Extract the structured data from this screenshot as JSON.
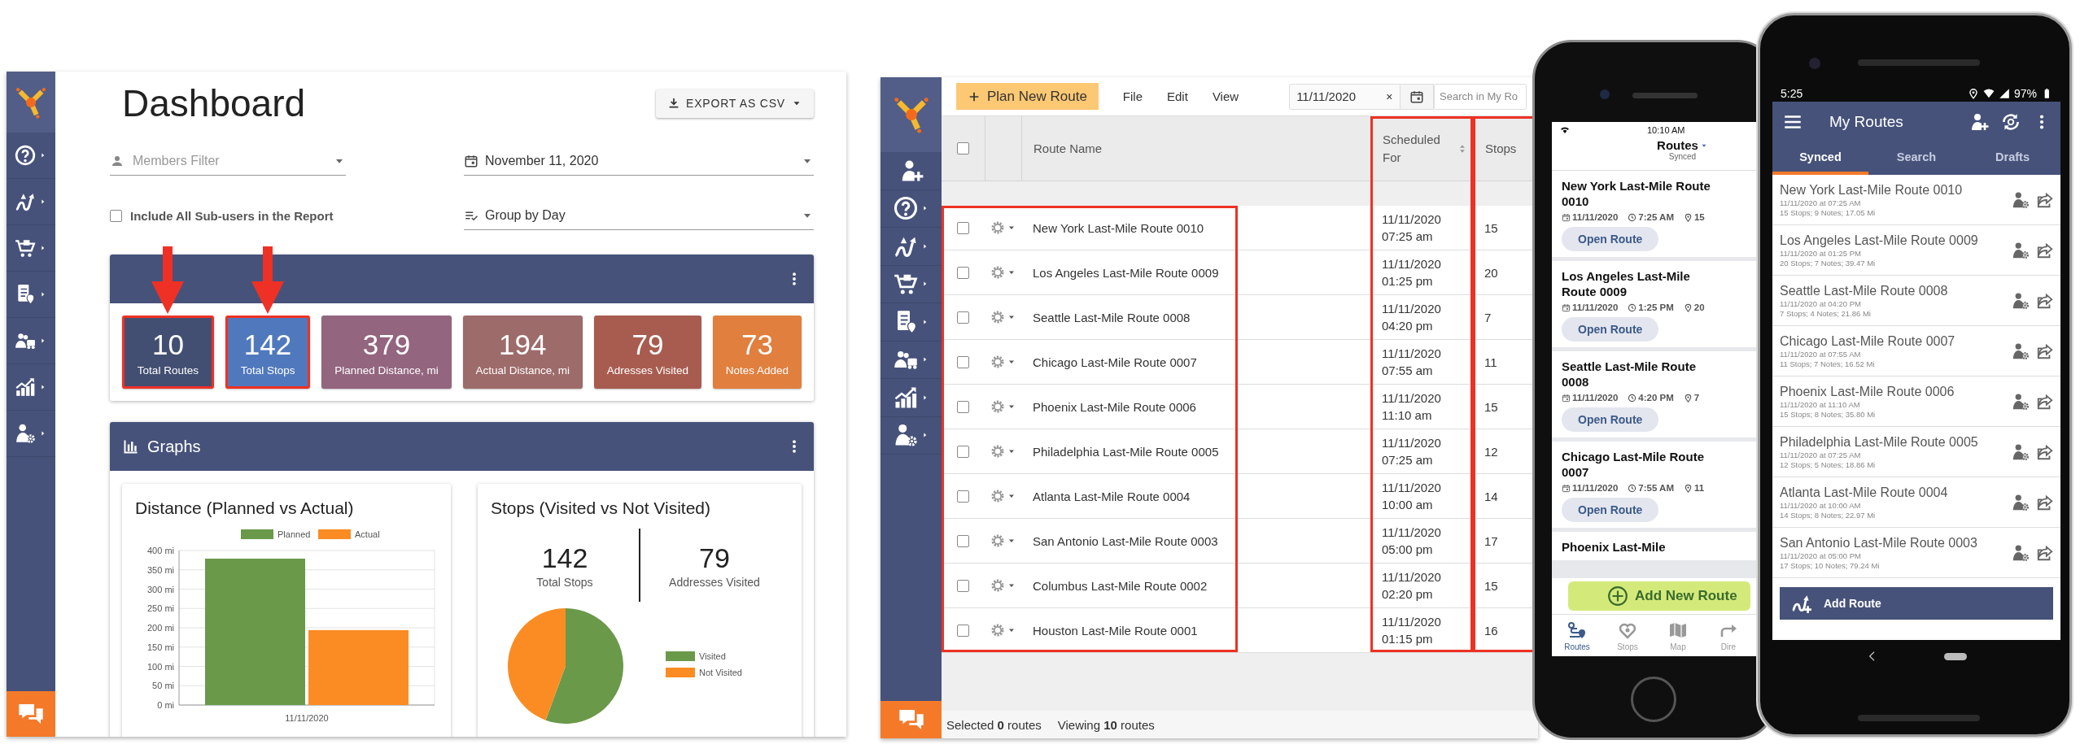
{
  "dashboard": {
    "title": "Dashboard",
    "export_button": {
      "label": "EXPORT AS CSV"
    },
    "members_filter": {
      "placeholder": "Members Filter"
    },
    "date_select": {
      "value": "November 11, 2020"
    },
    "subusers_checkbox": {
      "label": "Include All Sub-users in the Report",
      "checked": false
    },
    "group_select": {
      "value": "Group by Day"
    },
    "stats": [
      {
        "value": "10",
        "label": "Total Routes",
        "color": "#434f72",
        "highlighted": true
      },
      {
        "value": "142",
        "label": "Total Stops",
        "color": "#5079bd",
        "highlighted": true
      },
      {
        "value": "379",
        "label": "Planned Distance, mi",
        "color": "#93657f",
        "highlighted": false
      },
      {
        "value": "194",
        "label": "Actual Distance, mi",
        "color": "#9d6b6a",
        "highlighted": false
      },
      {
        "value": "79",
        "label": "Adresses Visited",
        "color": "#a85c50",
        "highlighted": false
      },
      {
        "value": "73",
        "label": "Notes Added",
        "color": "#e07f3e",
        "highlighted": false
      }
    ],
    "graphs": {
      "title": "Graphs",
      "distance": {
        "title": "Distance (Planned vs Actual)",
        "chart_data": {
          "type": "bar",
          "categories": [
            "11/11/2020"
          ],
          "series": [
            {
              "name": "Planned",
              "color": "#6a994a",
              "values": [
                379
              ]
            },
            {
              "name": "Actual",
              "color": "#fb8c23",
              "values": [
                194
              ]
            }
          ],
          "grid": true,
          "legend": true,
          "ylim": [
            0,
            400
          ],
          "yticks": [
            {
              "value": 0,
              "label": "0 mi"
            },
            {
              "value": 50,
              "label": "50 mi"
            },
            {
              "value": 100,
              "label": "100 mi"
            },
            {
              "value": 150,
              "label": "150 mi"
            },
            {
              "value": 200,
              "label": "200 mi"
            },
            {
              "value": 250,
              "label": "250 mi"
            },
            {
              "value": 300,
              "label": "300 mi"
            },
            {
              "value": 350,
              "label": "350 mi"
            },
            {
              "value": 400,
              "label": "400 mi"
            }
          ]
        }
      },
      "stops": {
        "title": "Stops (Visited vs Not Visited)",
        "figures": [
          {
            "value": "142",
            "label": "Total Stops"
          },
          {
            "value": "79",
            "label": "Addresses Visited"
          }
        ],
        "chart_data": {
          "type": "pie",
          "categories": [
            "Visited",
            "Not Visited"
          ],
          "values": [
            55.6,
            44.4
          ],
          "colors": [
            "#6a994a",
            "#fb8c23"
          ],
          "legend": true
        }
      }
    }
  },
  "routes_page": {
    "toolbar": {
      "plan_button": "Plan New Route",
      "menus": [
        "File",
        "Edit",
        "View"
      ],
      "date_field": {
        "value": "11/11/2020",
        "clear": "×"
      },
      "search": {
        "placeholder": "Search in My Ro"
      }
    },
    "table": {
      "select_all": {
        "checked": false
      },
      "columns": [
        {
          "label": "Route Name",
          "highlighted": true,
          "sortable": false
        },
        {
          "label": "Scheduled For",
          "highlighted": true,
          "sortable": true
        },
        {
          "label": "Stops",
          "highlighted": true,
          "sortable": false
        }
      ],
      "rows": [
        {
          "checked": false,
          "name": "New York Last-Mile Route 0010",
          "scheduled": "11/11/2020 07:25 am",
          "stops": "15"
        },
        {
          "checked": false,
          "name": "Los Angeles Last-Mile Route 0009",
          "scheduled": "11/11/2020 01:25 pm",
          "stops": "20"
        },
        {
          "checked": false,
          "name": "Seattle Last-Mile Route 0008",
          "scheduled": "11/11/2020 04:20 pm",
          "stops": "7"
        },
        {
          "checked": false,
          "name": "Chicago Last-Mile Route 0007",
          "scheduled": "11/11/2020 07:55 am",
          "stops": "11"
        },
        {
          "checked": false,
          "name": "Phoenix Last-Mile Route 0006",
          "scheduled": "11/11/2020 11:10 am",
          "stops": "15"
        },
        {
          "checked": false,
          "name": "Philadelphia Last-Mile Route 0005",
          "scheduled": "11/11/2020 07:25 am",
          "stops": "12"
        },
        {
          "checked": false,
          "name": "Atlanta Last-Mile Route 0004",
          "scheduled": "11/11/2020 10:00 am",
          "stops": "14"
        },
        {
          "checked": false,
          "name": "San Antonio Last-Mile Route 0003",
          "scheduled": "11/11/2020 05:00 pm",
          "stops": "17"
        },
        {
          "checked": false,
          "name": "Columbus Last-Mile Route 0002",
          "scheduled": "11/11/2020 02:20 pm",
          "stops": "15"
        },
        {
          "checked": false,
          "name": "Houston Last-Mile Route 0001",
          "scheduled": "11/11/2020 01:15 pm",
          "stops": "16"
        }
      ]
    },
    "footer": {
      "selected": "Selected **0** routes",
      "viewing": "Viewing **10** routes"
    }
  },
  "ios_app": {
    "status_time": "10:10 AM",
    "header": {
      "title": "Routes",
      "subtitle": "Synced"
    },
    "cards": [
      {
        "title": "New York Last-Mile Route 0010",
        "date": "11/11/2020",
        "time": "7:25 AM",
        "stops": "15",
        "button": "Open Route"
      },
      {
        "title": "Los Angeles Last-Mile Route 0009",
        "date": "11/11/2020",
        "time": "1:25 PM",
        "stops": "20",
        "button": "Open Route"
      },
      {
        "title": "Seattle Last-Mile Route 0008",
        "date": "11/11/2020",
        "time": "4:20 PM",
        "stops": "7",
        "button": "Open Route"
      },
      {
        "title": "Chicago Last-Mile Route 0007",
        "date": "11/11/2020",
        "time": "7:55 AM",
        "stops": "11",
        "button": "Open Route"
      },
      {
        "title": "Phoenix Last-Mile"
      }
    ],
    "add_button": "Add New Route",
    "tabs": [
      {
        "label": "Routes",
        "selected": true
      },
      {
        "label": "Stops",
        "selected": false
      },
      {
        "label": "Map",
        "selected": false
      },
      {
        "label": "Dire",
        "selected": false
      }
    ]
  },
  "android_app": {
    "status_time": "5:25",
    "battery": "97%",
    "title": "My Routes",
    "tabs": [
      {
        "label": "Synced",
        "selected": true
      },
      {
        "label": "Search",
        "selected": false
      },
      {
        "label": "Drafts",
        "selected": false
      }
    ],
    "routes": [
      {
        "name": "New York Last-Mile Route 0010",
        "when": "11/11/2020 at 07:25 AM",
        "summary": "15 Stops; 9 Notes; 17.05 Mi"
      },
      {
        "name": "Los Angeles Last-Mile Route 0009",
        "when": "11/11/2020 at 01:25 PM",
        "summary": "20 Stops; 7 Notes; 39.47 Mi"
      },
      {
        "name": "Seattle Last-Mile Route 0008",
        "when": "11/11/2020 at 04:20 PM",
        "summary": "7 Stops; 4 Notes; 21.86 Mi"
      },
      {
        "name": "Chicago Last-Mile Route 0007",
        "when": "11/11/2020 at 07:55 AM",
        "summary": "11 Stops; 7 Notes; 16.52 Mi"
      },
      {
        "name": "Phoenix Last-Mile Route 0006",
        "when": "11/11/2020 at 11:10 AM",
        "summary": "15 Stops; 8 Notes; 35.80 Mi"
      },
      {
        "name": "Philadelphia Last-Mile Route 0005",
        "when": "11/11/2020 at 07:25 AM",
        "summary": "12 Stops; 5 Notes; 18.86 Mi"
      },
      {
        "name": "Atlanta Last-Mile Route 0004",
        "when": "11/11/2020 at 10:00 AM",
        "summary": "14 Stops; 8 Notes; 22.97 Mi"
      },
      {
        "name": "San Antonio Last-Mile Route 0003",
        "when": "11/11/2020 at 05:00 PM",
        "summary": "17 Stops; 10 Notes; 79.24 Mi"
      }
    ],
    "add_button": "Add Route"
  }
}
